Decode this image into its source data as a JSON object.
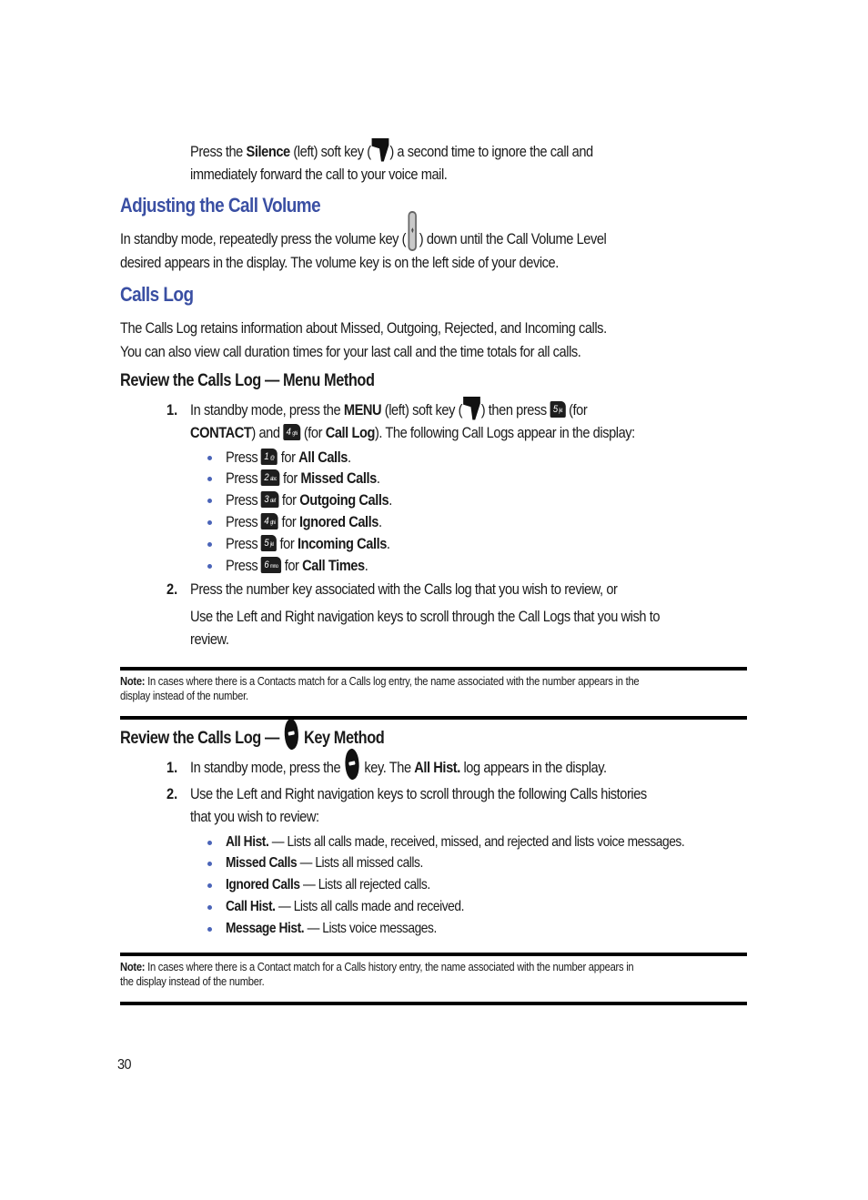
{
  "intro": {
    "line1_pre": "Press the ",
    "line1_bold": "Silence",
    "line1_mid": " (left) soft key (",
    "line1_post": ") a second time to ignore the call and",
    "line2": "immediately forward the call to your voice mail.",
    "icon": "left-soft-key-icon"
  },
  "volume_section": {
    "heading": "Adjusting the Call Volume",
    "line1_pre": "In standby mode, repeatedly press the volume key (",
    "line1_post": ") down until the Call Volume Level",
    "line2": "desired appears in the display. The volume key is on the left side of your device.",
    "icon": "volume-key-icon"
  },
  "calls_log_section": {
    "heading": "Calls Log",
    "para_line1": "The Calls Log retains information about Missed, Outgoing, Rejected, and Incoming calls.",
    "para_line2": "You can also view call duration times for your last call and the time totals for all calls."
  },
  "menu_method": {
    "heading": "Review the Calls Log — Menu Method",
    "step1": {
      "number": "1.",
      "pre": "In standby mode, press the ",
      "menu_bold": "MENU",
      "mid1": " (left) soft key (",
      "mid2": ") then press ",
      "mid3": " (for",
      "contact_bold": "CONTACT",
      "mid4": ") and ",
      "mid5": " (for ",
      "calllog_bold": "Call Log",
      "post": "). The following Call Logs appear in the display:",
      "key5": {
        "digit": "5",
        "letters": "jkl"
      },
      "key4": {
        "digit": "4",
        "letters": "ghi"
      }
    },
    "bullets": [
      {
        "press": "Press",
        "digit": "1",
        "letters": "@",
        "for": "for",
        "label": "All Calls",
        "end": "."
      },
      {
        "press": "Press",
        "digit": "2",
        "letters": "abc",
        "for": "for",
        "label": "Missed Calls",
        "end": "."
      },
      {
        "press": "Press",
        "digit": "3",
        "letters": "def",
        "for": "for",
        "label": "Outgoing Calls",
        "end": "."
      },
      {
        "press": "Press",
        "digit": "4",
        "letters": "ghi",
        "for": "for",
        "label": "Ignored Calls",
        "end": "."
      },
      {
        "press": "Press",
        "digit": "5",
        "letters": "jkl",
        "for": "for",
        "label": "Incoming Calls",
        "end": "."
      },
      {
        "press": "Press",
        "digit": "6",
        "letters": "mno",
        "for": "for",
        "label": "Call Times",
        "end": "."
      }
    ],
    "step2": {
      "number": "2.",
      "line1": "Press the number key associated with the Calls log that you wish to review, or",
      "line2": "Use the Left and Right navigation keys to scroll through the Call Logs that you wish to",
      "line3": "review."
    }
  },
  "note1": {
    "label": "Note:",
    "line1": " In cases where there is a Contacts match for a Calls log entry, the name associated with the number appears in the",
    "line2": "display instead of the number."
  },
  "key_method": {
    "heading_pre": "Review the Calls Log — ",
    "heading_post": " Key Method",
    "icon": "send-key-icon",
    "step1": {
      "number": "1.",
      "pre": "In standby mode, press the ",
      "mid": " key. The ",
      "bold": "All Hist.",
      "post": " log appears in the display."
    },
    "step2": {
      "number": "2.",
      "line1": "Use the Left and Right navigation keys to scroll through the following Calls histories",
      "line2": "that you wish to review:"
    },
    "bullets": [
      {
        "label": "All Hist.",
        "desc": " — Lists all calls made, received, missed, and rejected and lists voice messages."
      },
      {
        "label": "Missed Calls",
        "desc": " — Lists all missed calls."
      },
      {
        "label": "Ignored Calls",
        "desc": " — Lists all rejected calls."
      },
      {
        "label": "Call Hist.",
        "desc": " — Lists all calls made and received."
      },
      {
        "label": "Message Hist.",
        "desc": " — Lists voice messages."
      }
    ]
  },
  "note2": {
    "label": "Note:",
    "line1": " In cases where there is a Contact match for a Calls history entry, the name associated with the number appears in",
    "line2": "the display instead of the number."
  },
  "footer": {
    "page_number": "30"
  },
  "colors": {
    "heading": "#3a4fa3",
    "bullet": "#4a64b8",
    "text": "#1a1a1a"
  }
}
